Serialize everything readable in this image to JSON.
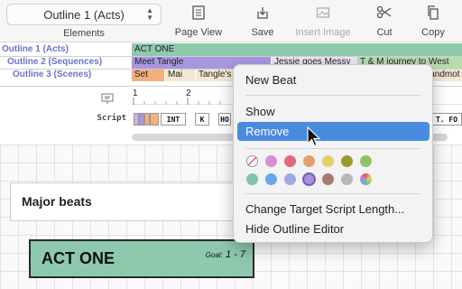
{
  "toolbar": {
    "outline_select": "Outline 1 (Acts)",
    "elements_label": "Elements",
    "page_view": "Page View",
    "save": "Save",
    "insert_image": "Insert Image",
    "cut": "Cut",
    "copy": "Copy"
  },
  "outline": {
    "labels": [
      "Outline 1 (Acts)",
      "Outline 2 (Sequences)",
      "Outline 3 (Scenes)"
    ],
    "row1": [
      "ACT ONE"
    ],
    "row2": [
      "Meet Tangle",
      "Jessie goes Messy",
      "T & M journey to West"
    ],
    "row3": [
      "Set",
      "Mai",
      "Tangle's",
      "landmot"
    ]
  },
  "ruler": [
    "1",
    "2"
  ],
  "script_label": "Script",
  "script_blocks": [
    "INT",
    "K",
    "HO",
    "T. FO"
  ],
  "board": {
    "major_beats": "Major beats",
    "act_title": "ACT ONE",
    "goal_label": "Goal:",
    "goal_value": "1 - 7"
  },
  "menu": {
    "new_beat": "New Beat",
    "show": "Show",
    "remove": "Remove",
    "change_target": "Change Target Script Length...",
    "hide_editor": "Hide Outline Editor",
    "swatch_colors_row1": [
      "none",
      "#d48fd6",
      "#e0687d",
      "#e3a06b",
      "#e5cf6a",
      "#9a9a2c",
      "#8fc46b"
    ],
    "swatch_colors_row2": [
      "#7fc4ab",
      "#6aa7e8",
      "#9fa8e0",
      "#a98fd9",
      "#a87a73",
      "#b8b8b8",
      "rainbow"
    ]
  },
  "colors": {
    "act_green": "#8ec9ad",
    "sequence_purple": "#a897e0",
    "scene_orange": "#f1b07c",
    "highlight_blue": "#4a8be0",
    "row_label_blue": "#6a73c8"
  }
}
